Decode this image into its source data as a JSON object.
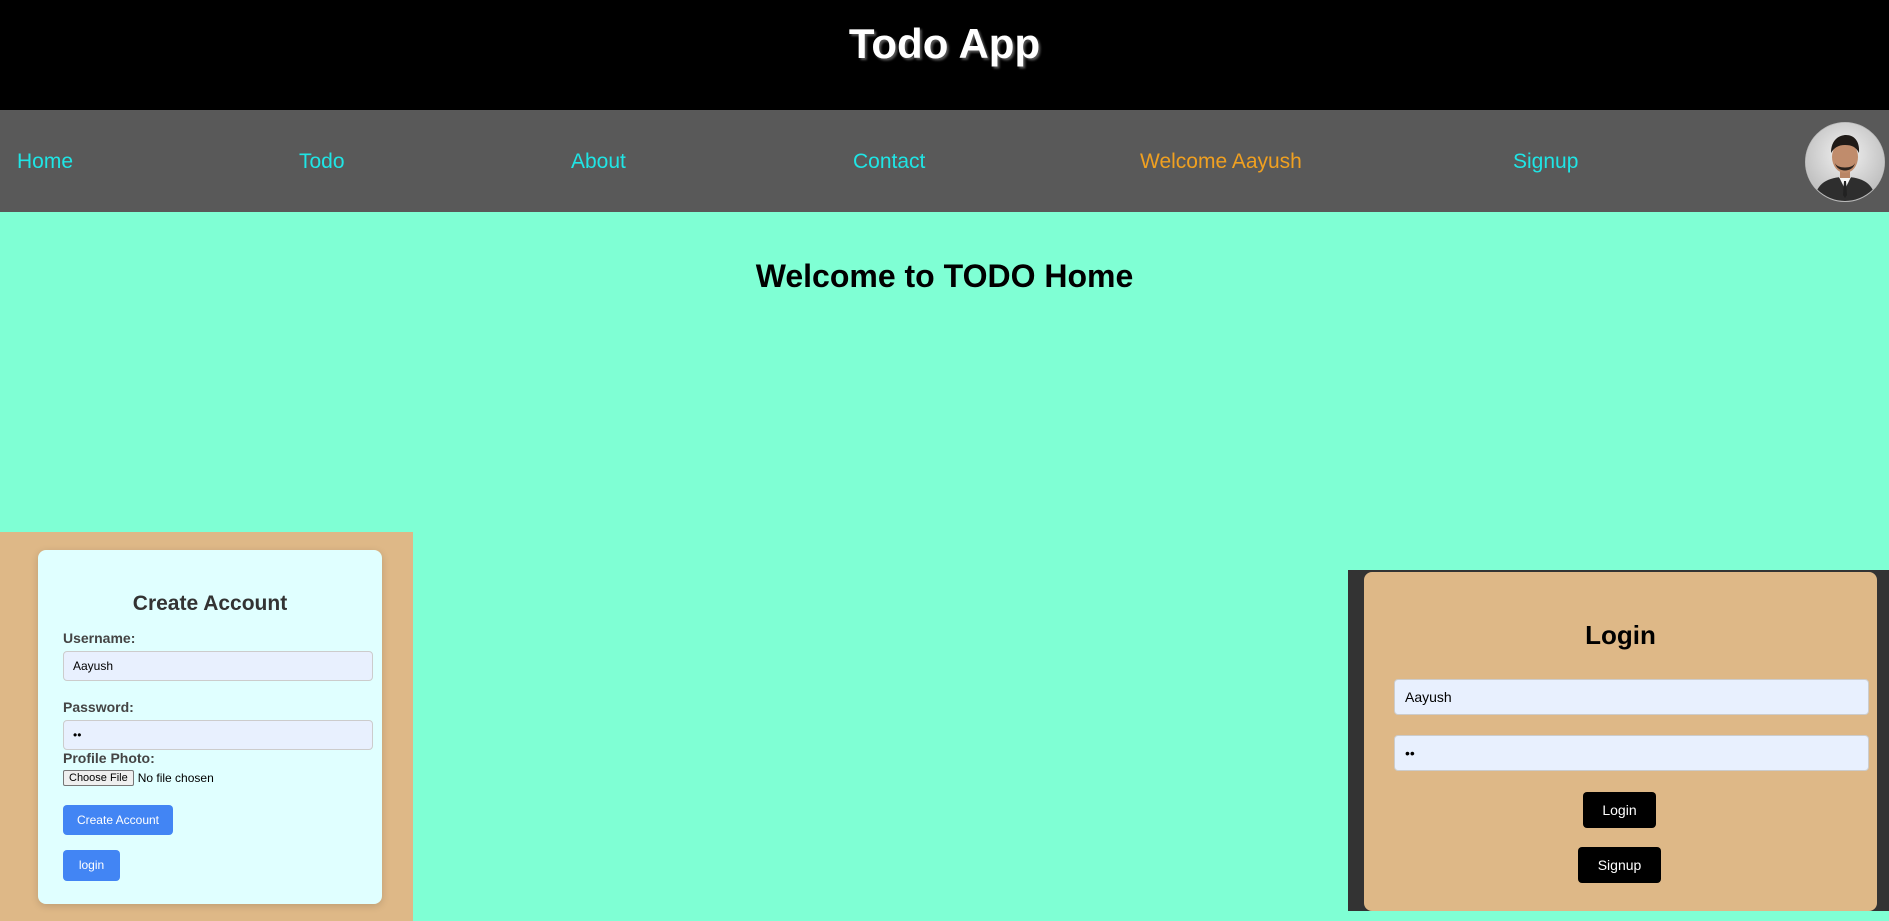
{
  "app": {
    "title": "Todo App"
  },
  "nav": {
    "home": "Home",
    "todo": "Todo",
    "about": "About",
    "contact": "Contact",
    "welcome": "Welcome Aayush",
    "signup": "Signup"
  },
  "main": {
    "heading": "Welcome to TODO Home"
  },
  "create_account": {
    "title": "Create Account",
    "username_label": "Username:",
    "username_value": "Aayush",
    "password_label": "Password:",
    "password_value": "••",
    "photo_label": "Profile Photo:",
    "choose_file": "Choose File",
    "no_file": "No file chosen",
    "create_button": "Create Account",
    "login_button": "login"
  },
  "login": {
    "title": "Login",
    "username_value": "Aayush",
    "password_value": "••",
    "login_button": "Login",
    "signup_button": "Signup"
  },
  "colors": {
    "background": "#7fffd4",
    "nav_link": "#1fe5e5",
    "welcome": "#f0a020",
    "panel": "#deb887",
    "primary_button": "#4285f4"
  }
}
